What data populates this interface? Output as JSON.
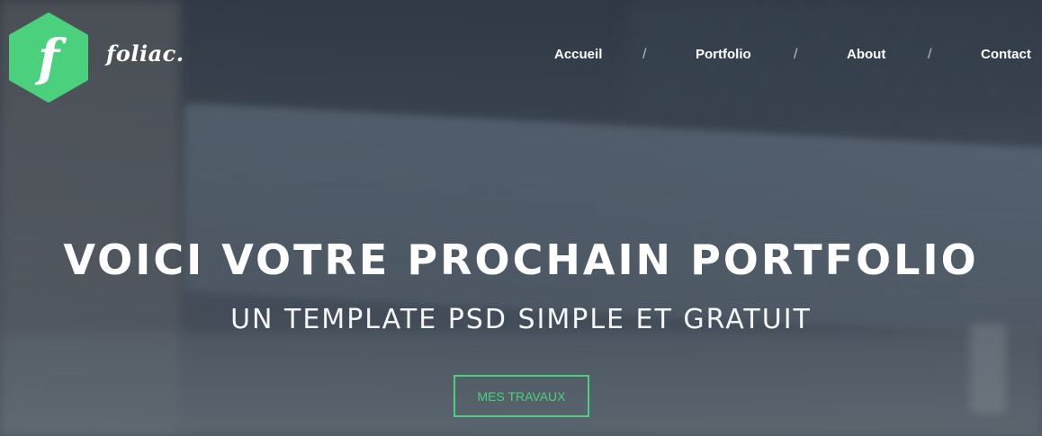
{
  "brand": {
    "logo_letter": "f",
    "name": "foliac.",
    "accent_color": "#4bd07e"
  },
  "nav": {
    "items": [
      {
        "label": "Accueil"
      },
      {
        "label": "Portfolio"
      },
      {
        "label": "About"
      },
      {
        "label": "Contact"
      }
    ],
    "separator": "/"
  },
  "hero": {
    "title": "Voici votre prochain portfolio",
    "subtitle": "Un template PSD simple et gratuit",
    "cta_label": "Mes travaux"
  }
}
